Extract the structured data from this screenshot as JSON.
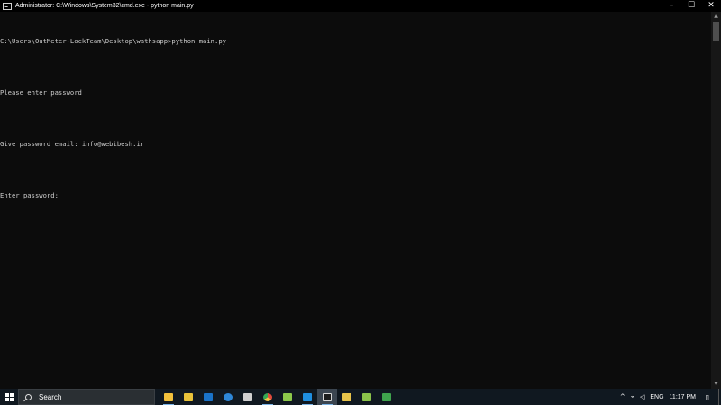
{
  "window": {
    "title": "Administrator: C:\\Windows\\System32\\cmd.exe - python  main.py",
    "icon": "cmd-icon",
    "controls": {
      "minimize": "–",
      "maximize": "☐",
      "close": "✕"
    }
  },
  "console": {
    "lines": [
      "C:\\Users\\OutMeter-LockTeam\\Desktop\\wathsapp>python main.py",
      "",
      "Please enter password",
      "",
      "Give password email: info@webibesh.ir",
      "",
      "Enter password:"
    ],
    "text_color": "#cccccc",
    "background_color": "#0c0c0c"
  },
  "scrollbar": {
    "up_arrow": "▲",
    "down_arrow": "▼"
  },
  "taskbar": {
    "search_label": "Search",
    "apps": [
      {
        "name": "file-explorer-icon",
        "color": "#f2c03c"
      },
      {
        "name": "store-icon",
        "color": "#e8c23a"
      },
      {
        "name": "outlook-icon",
        "color": "#1a73c9"
      },
      {
        "name": "app-blue-icon",
        "color": "#2e87d8"
      },
      {
        "name": "steam-icon",
        "color": "#d0d0d0"
      },
      {
        "name": "chrome-icon",
        "color": "#e14a3c"
      },
      {
        "name": "notepad-plus-icon",
        "color": "#8cc84b"
      },
      {
        "name": "vscode-icon",
        "color": "#1f8fe0"
      },
      {
        "name": "cmd-icon",
        "color": "#d6d6d6"
      },
      {
        "name": "app-yellow-icon",
        "color": "#e7c34a"
      },
      {
        "name": "android-icon",
        "color": "#8bc34a"
      },
      {
        "name": "app-green-icon",
        "color": "#3fa34d"
      }
    ],
    "tray": {
      "chevron": "^",
      "network": "⌁",
      "volume": "◁",
      "language": "ENG",
      "time": "11:17 PM",
      "notification": "▯"
    },
    "colors": {
      "background": "#101820",
      "active_app": "#3b4550",
      "running_indicator": "#7ab3e6"
    }
  }
}
